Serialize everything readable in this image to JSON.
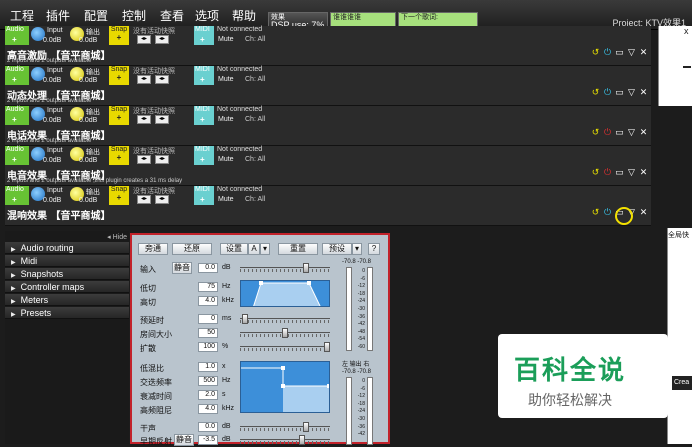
{
  "menu": [
    "工程",
    "插件",
    "配置",
    "控制",
    "查看",
    "选项",
    "帮助"
  ],
  "status": {
    "dsp_label": "效果",
    "dsp_value": "DSP use: 7%",
    "box2": "谁谁谁谁",
    "box3": "下一个歌词:"
  },
  "project_title": "Project: KTV效果1",
  "right_window": {
    "close": "x"
  },
  "strip_common": {
    "audio": "Audio",
    "input": "Input",
    "output": "输出",
    "snap": "Snap",
    "midi": "MIDI",
    "not_connected": "Not connected",
    "no_snapshot": "没有活动快照",
    "mute": "Mute",
    "channel": "Ch: All",
    "input_db": "0.0dB",
    "output_db": "0.0dB",
    "plus": "+"
  },
  "strips": [
    {
      "name": "高音激励 【音平商城】",
      "desc": "2 inputs and 2 outputs available"
    },
    {
      "name": "动态处理 【音平商城】",
      "desc": "2 inputs and 2 outputs available"
    },
    {
      "name": "电话效果 【音平商城】",
      "desc": "2 inputs and 2 outputs available"
    },
    {
      "name": "电音效果 【音平商城】",
      "desc": "2 inputs and 2 outputs available ,this plugin creates a 31 ms delay"
    },
    {
      "name": "混响效果 【音平商城】",
      "desc": ""
    }
  ],
  "sidebar": {
    "hide": "◂ Hide",
    "items": [
      "Audio routing",
      "Midi",
      "Snapshots",
      "Controller maps",
      "Meters",
      "Presets"
    ]
  },
  "reverb_panel": {
    "buttons": [
      "旁通",
      "还原",
      "设置",
      "A",
      "重置",
      "预设",
      "?"
    ],
    "params": [
      {
        "label": "输入",
        "sub": "静音",
        "value": "0.0",
        "unit": "dB"
      },
      {
        "label": "低切",
        "value": "75",
        "unit": "Hz"
      },
      {
        "label": "高切",
        "value": "4.0",
        "unit": "kHz"
      },
      {
        "label": "预延时",
        "value": "0",
        "unit": "ms"
      },
      {
        "label": "房间大小",
        "value": "50",
        "unit": ""
      },
      {
        "label": "扩散",
        "value": "100",
        "unit": "%"
      },
      {
        "label": "低混比",
        "value": "1.0",
        "unit": "x"
      },
      {
        "label": "交迭频率",
        "value": "500",
        "unit": "Hz"
      },
      {
        "label": "衰减时间",
        "value": "2.0",
        "unit": "s"
      },
      {
        "label": "高频阻尼",
        "value": "4.0",
        "unit": "kHz"
      },
      {
        "label": "干声",
        "value": "0.0",
        "unit": "dB"
      },
      {
        "label": "早期反射",
        "sub": "静音",
        "value": "-3.5",
        "unit": "dB"
      }
    ],
    "slider_levels": {
      "input": 0.75,
      "predelay": 0.02,
      "room_size": 0.5,
      "diffusion": 1.0,
      "dry": 0.75,
      "early": 0.7
    },
    "meter_head": "-70.8  -70.8",
    "meter_scale": [
      "0",
      "-6",
      "-12",
      "-18",
      "-24",
      "-30",
      "-36",
      "-42",
      "-48",
      "-54",
      "-60"
    ],
    "lr_label": "左 输出 右"
  },
  "watermark": {
    "title": "百科全说",
    "subtitle": "助你轻松解决"
  },
  "side_window": {
    "title": "全局快",
    "button": "Crea"
  }
}
